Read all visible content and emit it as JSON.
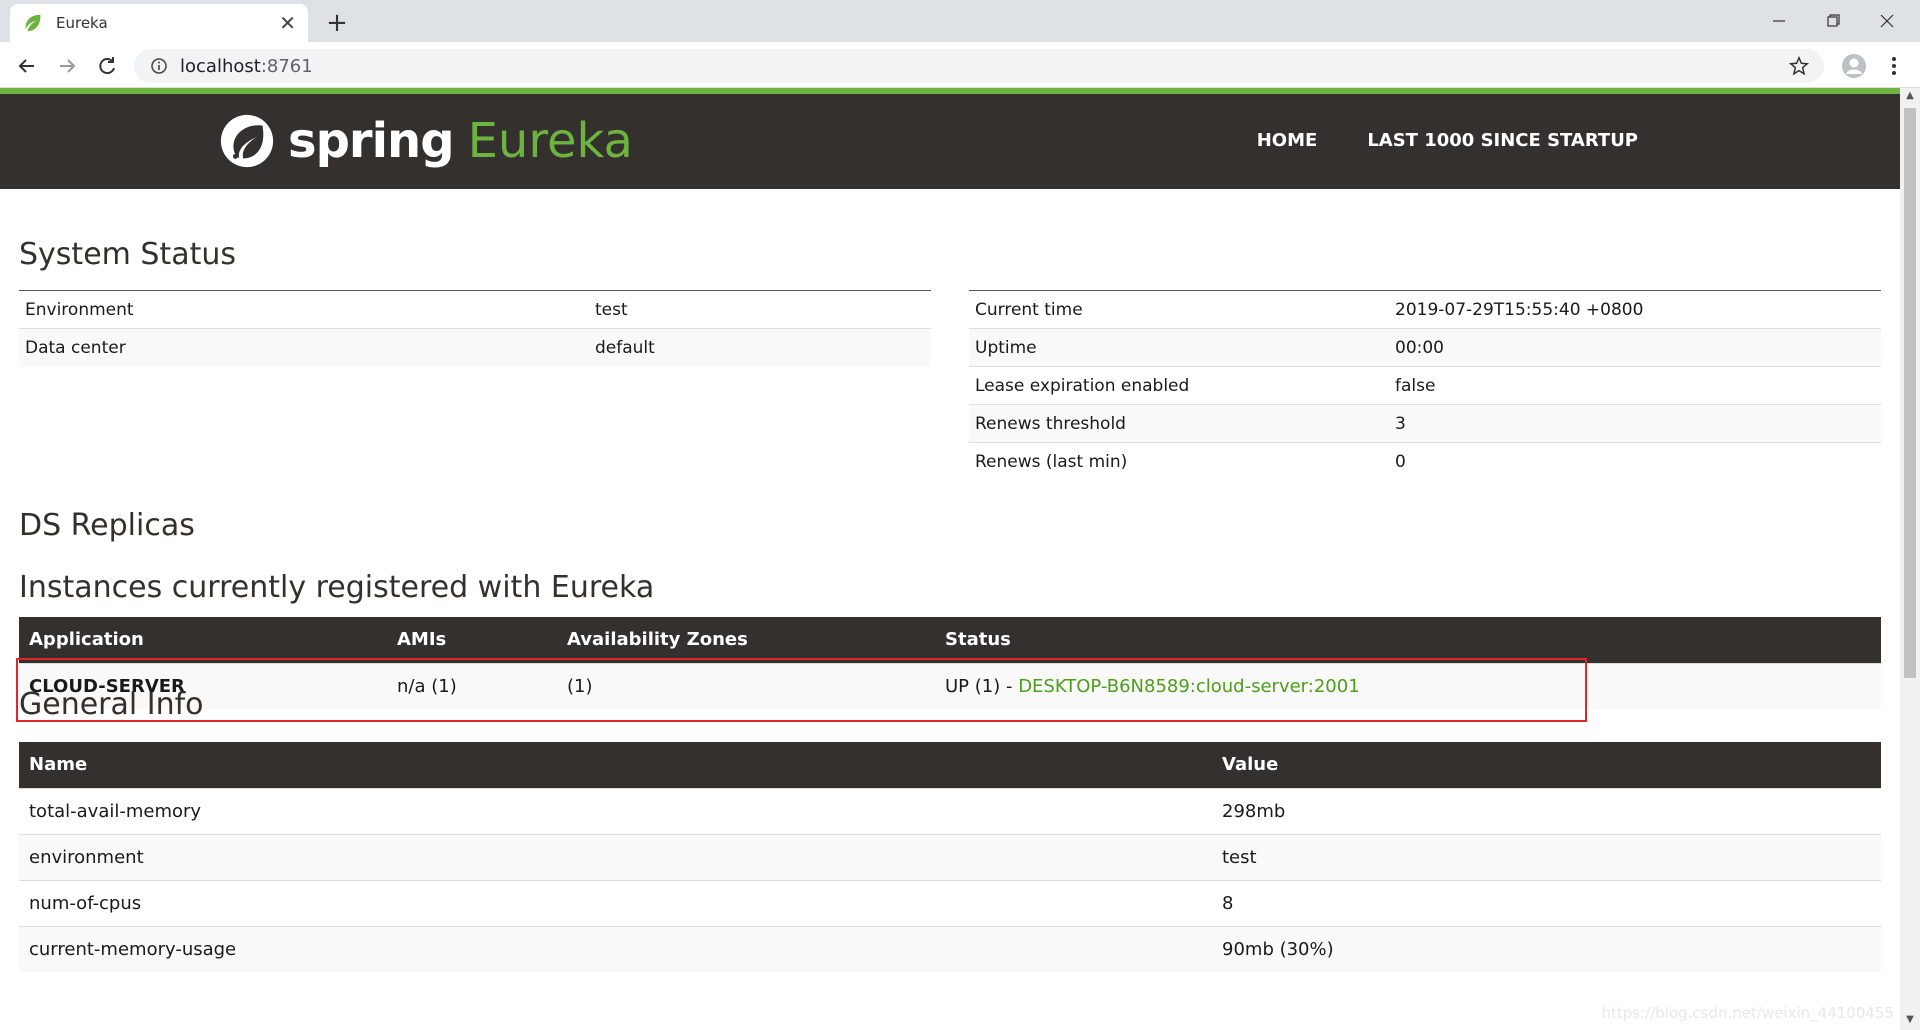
{
  "browser": {
    "tab_title": "Eureka",
    "url_host": "localhost",
    "url_port": ":8761"
  },
  "navbar": {
    "brand_spring": "spring",
    "brand_eureka": "Eureka",
    "home": "HOME",
    "last1000": "LAST 1000 SINCE STARTUP"
  },
  "system_status": {
    "title": "System Status",
    "left": [
      {
        "key": "Environment",
        "value": "test"
      },
      {
        "key": "Data center",
        "value": "default"
      }
    ],
    "right": [
      {
        "key": "Current time",
        "value": "2019-07-29T15:55:40 +0800"
      },
      {
        "key": "Uptime",
        "value": "00:00"
      },
      {
        "key": "Lease expiration enabled",
        "value": "false"
      },
      {
        "key": "Renews threshold",
        "value": "3"
      },
      {
        "key": "Renews (last min)",
        "value": "0"
      }
    ]
  },
  "ds_replicas": {
    "title": "DS Replicas"
  },
  "instances": {
    "title": "Instances currently registered with Eureka",
    "headers": [
      "Application",
      "AMIs",
      "Availability Zones",
      "Status"
    ],
    "rows": [
      {
        "application": "CLOUD-SERVER",
        "amis": "n/a (1)",
        "zones": "(1)",
        "status_prefix": "UP (1) - ",
        "status_link": "DESKTOP-B6N8589:cloud-server:2001"
      }
    ]
  },
  "general_info": {
    "title": "General Info",
    "headers": [
      "Name",
      "Value"
    ],
    "rows": [
      {
        "name": "total-avail-memory",
        "value": "298mb"
      },
      {
        "name": "environment",
        "value": "test"
      },
      {
        "name": "num-of-cpus",
        "value": "8"
      },
      {
        "name": "current-memory-usage",
        "value": "90mb (30%)"
      }
    ]
  },
  "watermark": "https://blog.csdn.net/weixin_44100455",
  "colors": {
    "spring_green": "#6db33f",
    "navbar_dark": "#34302d",
    "link_green": "#4c9e19",
    "highlight_red": "#e0262b"
  }
}
